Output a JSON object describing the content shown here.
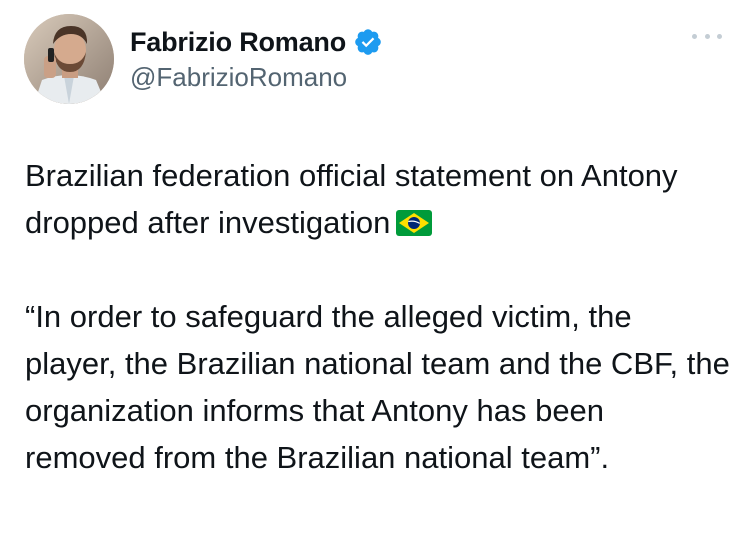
{
  "author": {
    "display_name": "Fabrizio Romano",
    "handle": "@FabrizioRomano",
    "verified": true,
    "avatar_icon": "profile-photo",
    "verified_color": "#1d9bf0"
  },
  "tweet": {
    "paragraph_1": "Brazilian federation official statement on Antony dropped after investigation",
    "paragraph_1_emoji": "brazil-flag-icon",
    "paragraph_2": "“In order to safeguard the alleged victim, the player, the Brazilian national team and the CBF, the organization informs that Antony has been removed from the Brazilian national team”."
  },
  "menu": {
    "icon": "more-options-icon"
  },
  "colors": {
    "text_primary": "#0f1419",
    "text_secondary": "#536471",
    "more_dots": "#c4cdd4"
  }
}
